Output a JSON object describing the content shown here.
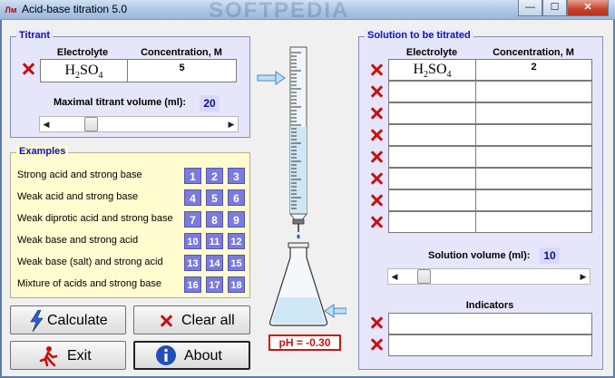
{
  "window": {
    "title": "Acid-base titration 5.0",
    "app_icon_text": "Лм",
    "minimize": "—",
    "maximize": "☐",
    "close": "✕",
    "watermark": "SOFTPEDIA"
  },
  "titrant": {
    "legend": "Titrant",
    "col_electrolyte": "Electrolyte",
    "col_concentration": "Concentration, M",
    "row": {
      "formula_base": "H",
      "formula_sub1": "2",
      "formula_mid": "SO",
      "formula_sub2": "4",
      "concentration": "5"
    },
    "max_volume_label": "Maximal titrant volume (ml):",
    "max_volume_value": "20",
    "slider_fraction": 0.2
  },
  "examples": {
    "legend": "Examples",
    "rows": [
      {
        "label": "Strong acid and strong base",
        "buttons": [
          "1",
          "2",
          "3"
        ]
      },
      {
        "label": "Weak acid and strong base",
        "buttons": [
          "4",
          "5",
          "6"
        ]
      },
      {
        "label": "Weak diprotic acid and strong base",
        "buttons": [
          "7",
          "8",
          "9"
        ]
      },
      {
        "label": "Weak base and strong acid",
        "buttons": [
          "10",
          "11",
          "12"
        ]
      },
      {
        "label": "Weak base (salt) and strong acid",
        "buttons": [
          "13",
          "14",
          "15"
        ]
      },
      {
        "label": "Mixture of acids and strong base",
        "buttons": [
          "16",
          "17",
          "18"
        ]
      }
    ]
  },
  "buttons": {
    "calculate": "Calculate",
    "clear_all": "Clear all",
    "exit": "Exit",
    "about": "About"
  },
  "ph_readout": "pH = -0.30",
  "solution": {
    "legend": "Solution to be titrated",
    "col_electrolyte": "Electrolyte",
    "col_concentration": "Concentration, M",
    "rows": [
      {
        "formula_base": "H",
        "formula_sub1": "2",
        "formula_mid": "SO",
        "formula_sub2": "4",
        "concentration": "2"
      },
      {
        "formula_base": "",
        "formula_sub1": "",
        "formula_mid": "",
        "formula_sub2": "",
        "concentration": ""
      },
      {
        "formula_base": "",
        "formula_sub1": "",
        "formula_mid": "",
        "formula_sub2": "",
        "concentration": ""
      },
      {
        "formula_base": "",
        "formula_sub1": "",
        "formula_mid": "",
        "formula_sub2": "",
        "concentration": ""
      },
      {
        "formula_base": "",
        "formula_sub1": "",
        "formula_mid": "",
        "formula_sub2": "",
        "concentration": ""
      },
      {
        "formula_base": "",
        "formula_sub1": "",
        "formula_mid": "",
        "formula_sub2": "",
        "concentration": ""
      },
      {
        "formula_base": "",
        "formula_sub1": "",
        "formula_mid": "",
        "formula_sub2": "",
        "concentration": ""
      },
      {
        "formula_base": "",
        "formula_sub1": "",
        "formula_mid": "",
        "formula_sub2": "",
        "concentration": ""
      }
    ],
    "volume_label": "Solution volume (ml):",
    "volume_value": "10",
    "slider_fraction": 0.1,
    "indicators_label": "Indicators"
  },
  "colors": {
    "accent_blue": "#1010c0",
    "delete_red": "#c81010",
    "example_button": "#7b7bdc",
    "ph_red": "#d01010"
  }
}
